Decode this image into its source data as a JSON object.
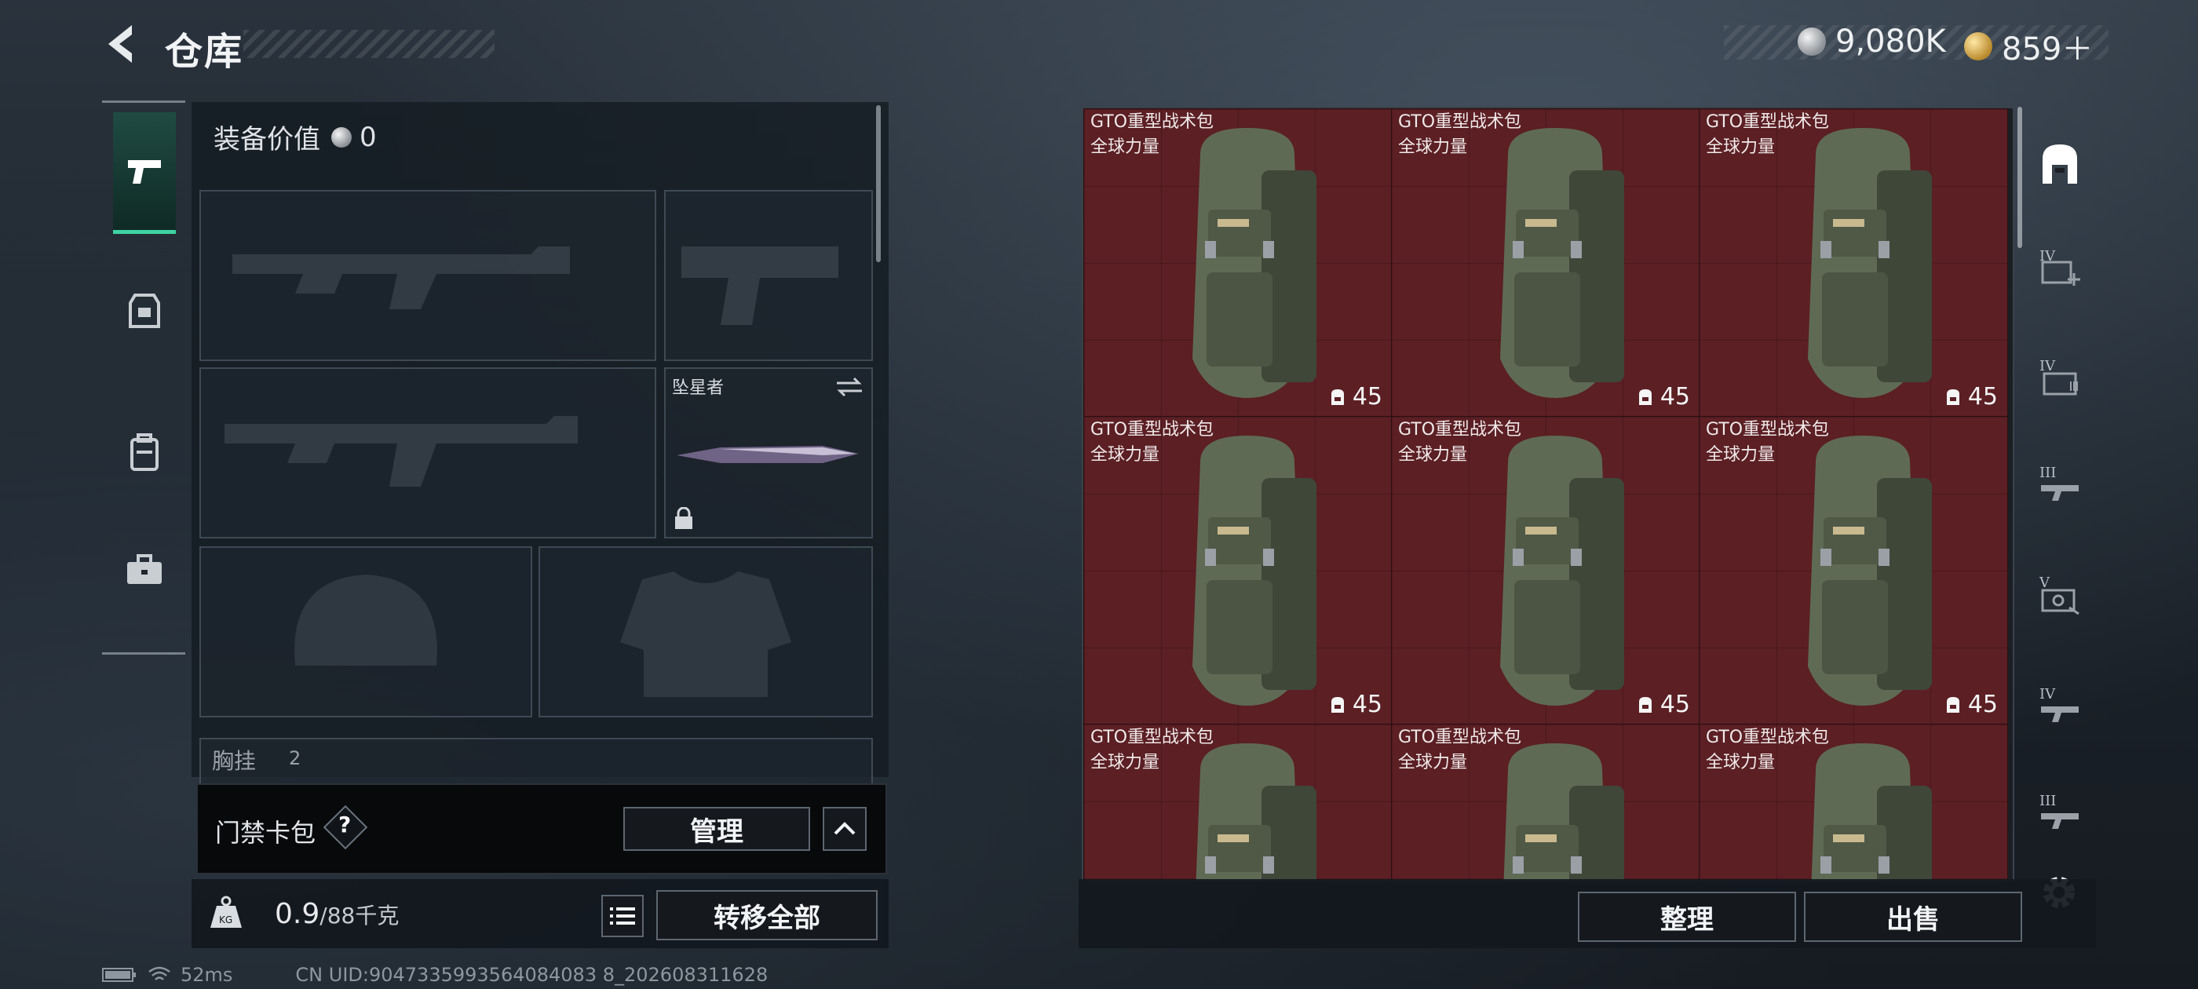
{
  "header": {
    "title": "仓库",
    "currency_silver": "9,080K",
    "currency_gold": "859＋"
  },
  "rail": {
    "items": [
      {
        "icon": "pistol-icon",
        "active": true
      },
      {
        "icon": "rig-icon",
        "active": false
      },
      {
        "icon": "backpack-icon",
        "active": false
      },
      {
        "icon": "case-icon",
        "active": false
      }
    ]
  },
  "equipment": {
    "value_label": "装备价值",
    "value": "0",
    "melee_label": "坠星者",
    "chest_label": "胸挂",
    "chest_count": "2"
  },
  "card_pack": {
    "label": "门禁卡包",
    "help": "?",
    "manage_button": "管理"
  },
  "weight": {
    "current": "0.9",
    "max": "/88千克",
    "transfer_all_button": "转移全部"
  },
  "storage": {
    "items": [
      {
        "name": "GTO重型战术包",
        "maker": "全球力量",
        "capacity": "45"
      },
      {
        "name": "GTO重型战术包",
        "maker": "全球力量",
        "capacity": "45"
      },
      {
        "name": "GTO重型战术包",
        "maker": "全球力量",
        "capacity": "45"
      },
      {
        "name": "GTO重型战术包",
        "maker": "全球力量",
        "capacity": "45"
      },
      {
        "name": "GTO重型战术包",
        "maker": "全球力量",
        "capacity": "45"
      },
      {
        "name": "GTO重型战术包",
        "maker": "全球力量",
        "capacity": "45"
      },
      {
        "name": "GTO重型战术包",
        "maker": "全球力量",
        "capacity": ""
      },
      {
        "name": "GTO重型战术包",
        "maker": "全球力量",
        "capacity": ""
      },
      {
        "name": "GTO重型战术包",
        "maker": "全球力量",
        "capacity": ""
      }
    ],
    "sort_button": "整理",
    "sell_button": "出售"
  },
  "filters": [
    {
      "tier": "",
      "icon": "storage-icon"
    },
    {
      "tier": "IV",
      "icon": "medkit-icon"
    },
    {
      "tier": "IV",
      "icon": "ammo-icon"
    },
    {
      "tier": "III",
      "icon": "gun-icon"
    },
    {
      "tier": "V",
      "icon": "key-icon"
    },
    {
      "tier": "IV",
      "icon": "gun2-icon"
    },
    {
      "tier": "III",
      "icon": "gun3-icon"
    }
  ],
  "status": {
    "ping": "52ms",
    "uid": "CN UID:9047335993564084083 8_202608311628"
  },
  "colors": {
    "accent_green": "#3ed3a2",
    "item_bg_red": "#5b1f24"
  }
}
